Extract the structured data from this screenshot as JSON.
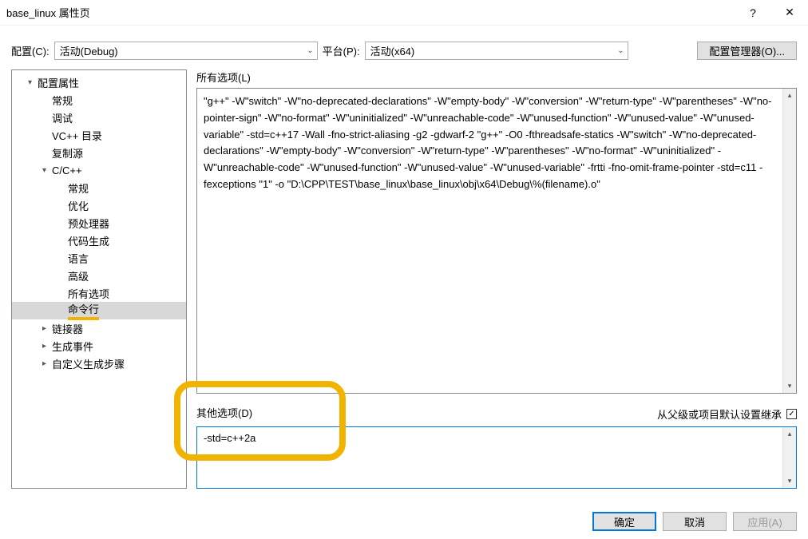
{
  "titlebar": {
    "title": "base_linux 属性页",
    "help": "?",
    "close": "✕"
  },
  "config_row": {
    "config_label": "配置(C):",
    "config_value": "活动(Debug)",
    "platform_label": "平台(P):",
    "platform_value": "活动(x64)",
    "manager_btn": "配置管理器(O)..."
  },
  "tree": {
    "root": "配置属性",
    "items": {
      "general": "常规",
      "debug": "调试",
      "vcdir": "VC++ 目录",
      "copysource": "复制源",
      "cpp": "C/C++",
      "cpp_general": "常规",
      "cpp_opt": "优化",
      "cpp_preproc": "预处理器",
      "cpp_codegen": "代码生成",
      "cpp_lang": "语言",
      "cpp_adv": "高级",
      "cpp_allopt": "所有选项",
      "cpp_cmdline": "命令行",
      "linker": "链接器",
      "buildevents": "生成事件",
      "custombuild": "自定义生成步骤"
    }
  },
  "right": {
    "all_options_label": "所有选项(L)",
    "all_options_text": "\"g++\" -W\"switch\" -W\"no-deprecated-declarations\" -W\"empty-body\" -W\"conversion\" -W\"return-type\" -W\"parentheses\" -W\"no-pointer-sign\" -W\"no-format\" -W\"uninitialized\" -W\"unreachable-code\" -W\"unused-function\" -W\"unused-value\" -W\"unused-variable\" -std=c++17 -Wall -fno-strict-aliasing -g2 -gdwarf-2 \"g++\" -O0 -fthreadsafe-statics -W\"switch\" -W\"no-deprecated-declarations\" -W\"empty-body\" -W\"conversion\" -W\"return-type\" -W\"parentheses\" -W\"no-format\" -W\"uninitialized\" -W\"unreachable-code\" -W\"unused-function\" -W\"unused-value\" -W\"unused-variable\" -frtti -fno-omit-frame-pointer -std=c11 -fexceptions \"1\" -o \"D:\\CPP\\TEST\\base_linux\\base_linux\\obj\\x64\\Debug\\%(filename).o\"",
    "other_options_label": "其他选项(D)",
    "inherit_label": "从父级或项目默认设置继承",
    "inherit_checked": "✓",
    "other_options_value": "-std=c++2a"
  },
  "buttons": {
    "ok": "确定",
    "cancel": "取消",
    "apply": "应用(A)"
  }
}
